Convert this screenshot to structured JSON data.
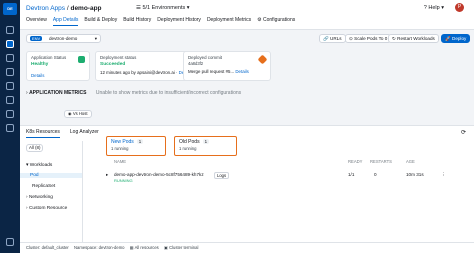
{
  "header": {
    "app_group": "Devtron Apps",
    "separator": "/",
    "app_name": "demo-app",
    "env_selector": "5/1 Environments",
    "help": "Help",
    "avatar_letter": "P"
  },
  "tabs": [
    "Overview",
    "App Details",
    "Build & Deploy",
    "Build History",
    "Deployment History",
    "Deployment Metrics",
    "Configurations"
  ],
  "toolbar": {
    "env_tag": "ENV",
    "env_name": "devtron-demo",
    "urls": "URLs",
    "scale": "Scale Pods To 0",
    "restart": "Restart Workloads",
    "deploy": "Deploy"
  },
  "cards": {
    "app_status": {
      "title": "Application Status",
      "value": "Healthy",
      "link": "Details"
    },
    "deploy_status": {
      "title": "Deployment status",
      "value": "Succeeded",
      "meta": "12 minutes ago by apsaini@devtron.ai",
      "link": "Details"
    },
    "deployed_commit": {
      "title": "Deployed commit",
      "hash": "4a8d3f2",
      "message": "Merge pull request #5...",
      "link": "Details"
    }
  },
  "metrics": {
    "title": "APPLICATION METRICS",
    "note": "Unable to show metrics due to insufficient/incorrect configurations"
  },
  "live_tag": "Vs Host",
  "panel": {
    "tab1": "K8s Resources",
    "tab2": "Log Analyzer",
    "all_label": "All (8)",
    "nav": [
      "Workloads",
      "Pod",
      "ReplicaSet",
      "Networking",
      "Custom Resource"
    ]
  },
  "new_pods": {
    "title": "New Pods",
    "count": "1",
    "sub": "1 running"
  },
  "old_pods": {
    "title": "Old Pods",
    "count": "1",
    "sub": "1 running"
  },
  "table": {
    "headers": [
      "NAME",
      "READY",
      "RESTARTS",
      "AGE"
    ],
    "row": {
      "name": "demo-app-devtron-demo-5c8f756489-kh7kz",
      "status": "RUNNING",
      "logs": "Logs",
      "ready": "1/1",
      "restarts": "0",
      "age": "10m 31s"
    }
  },
  "footer": {
    "cluster": "Cluster: default_cluster",
    "namespace": "Namespace: devtron-demo",
    "all_resources": "All resources",
    "terminal": "Cluster terminal"
  }
}
